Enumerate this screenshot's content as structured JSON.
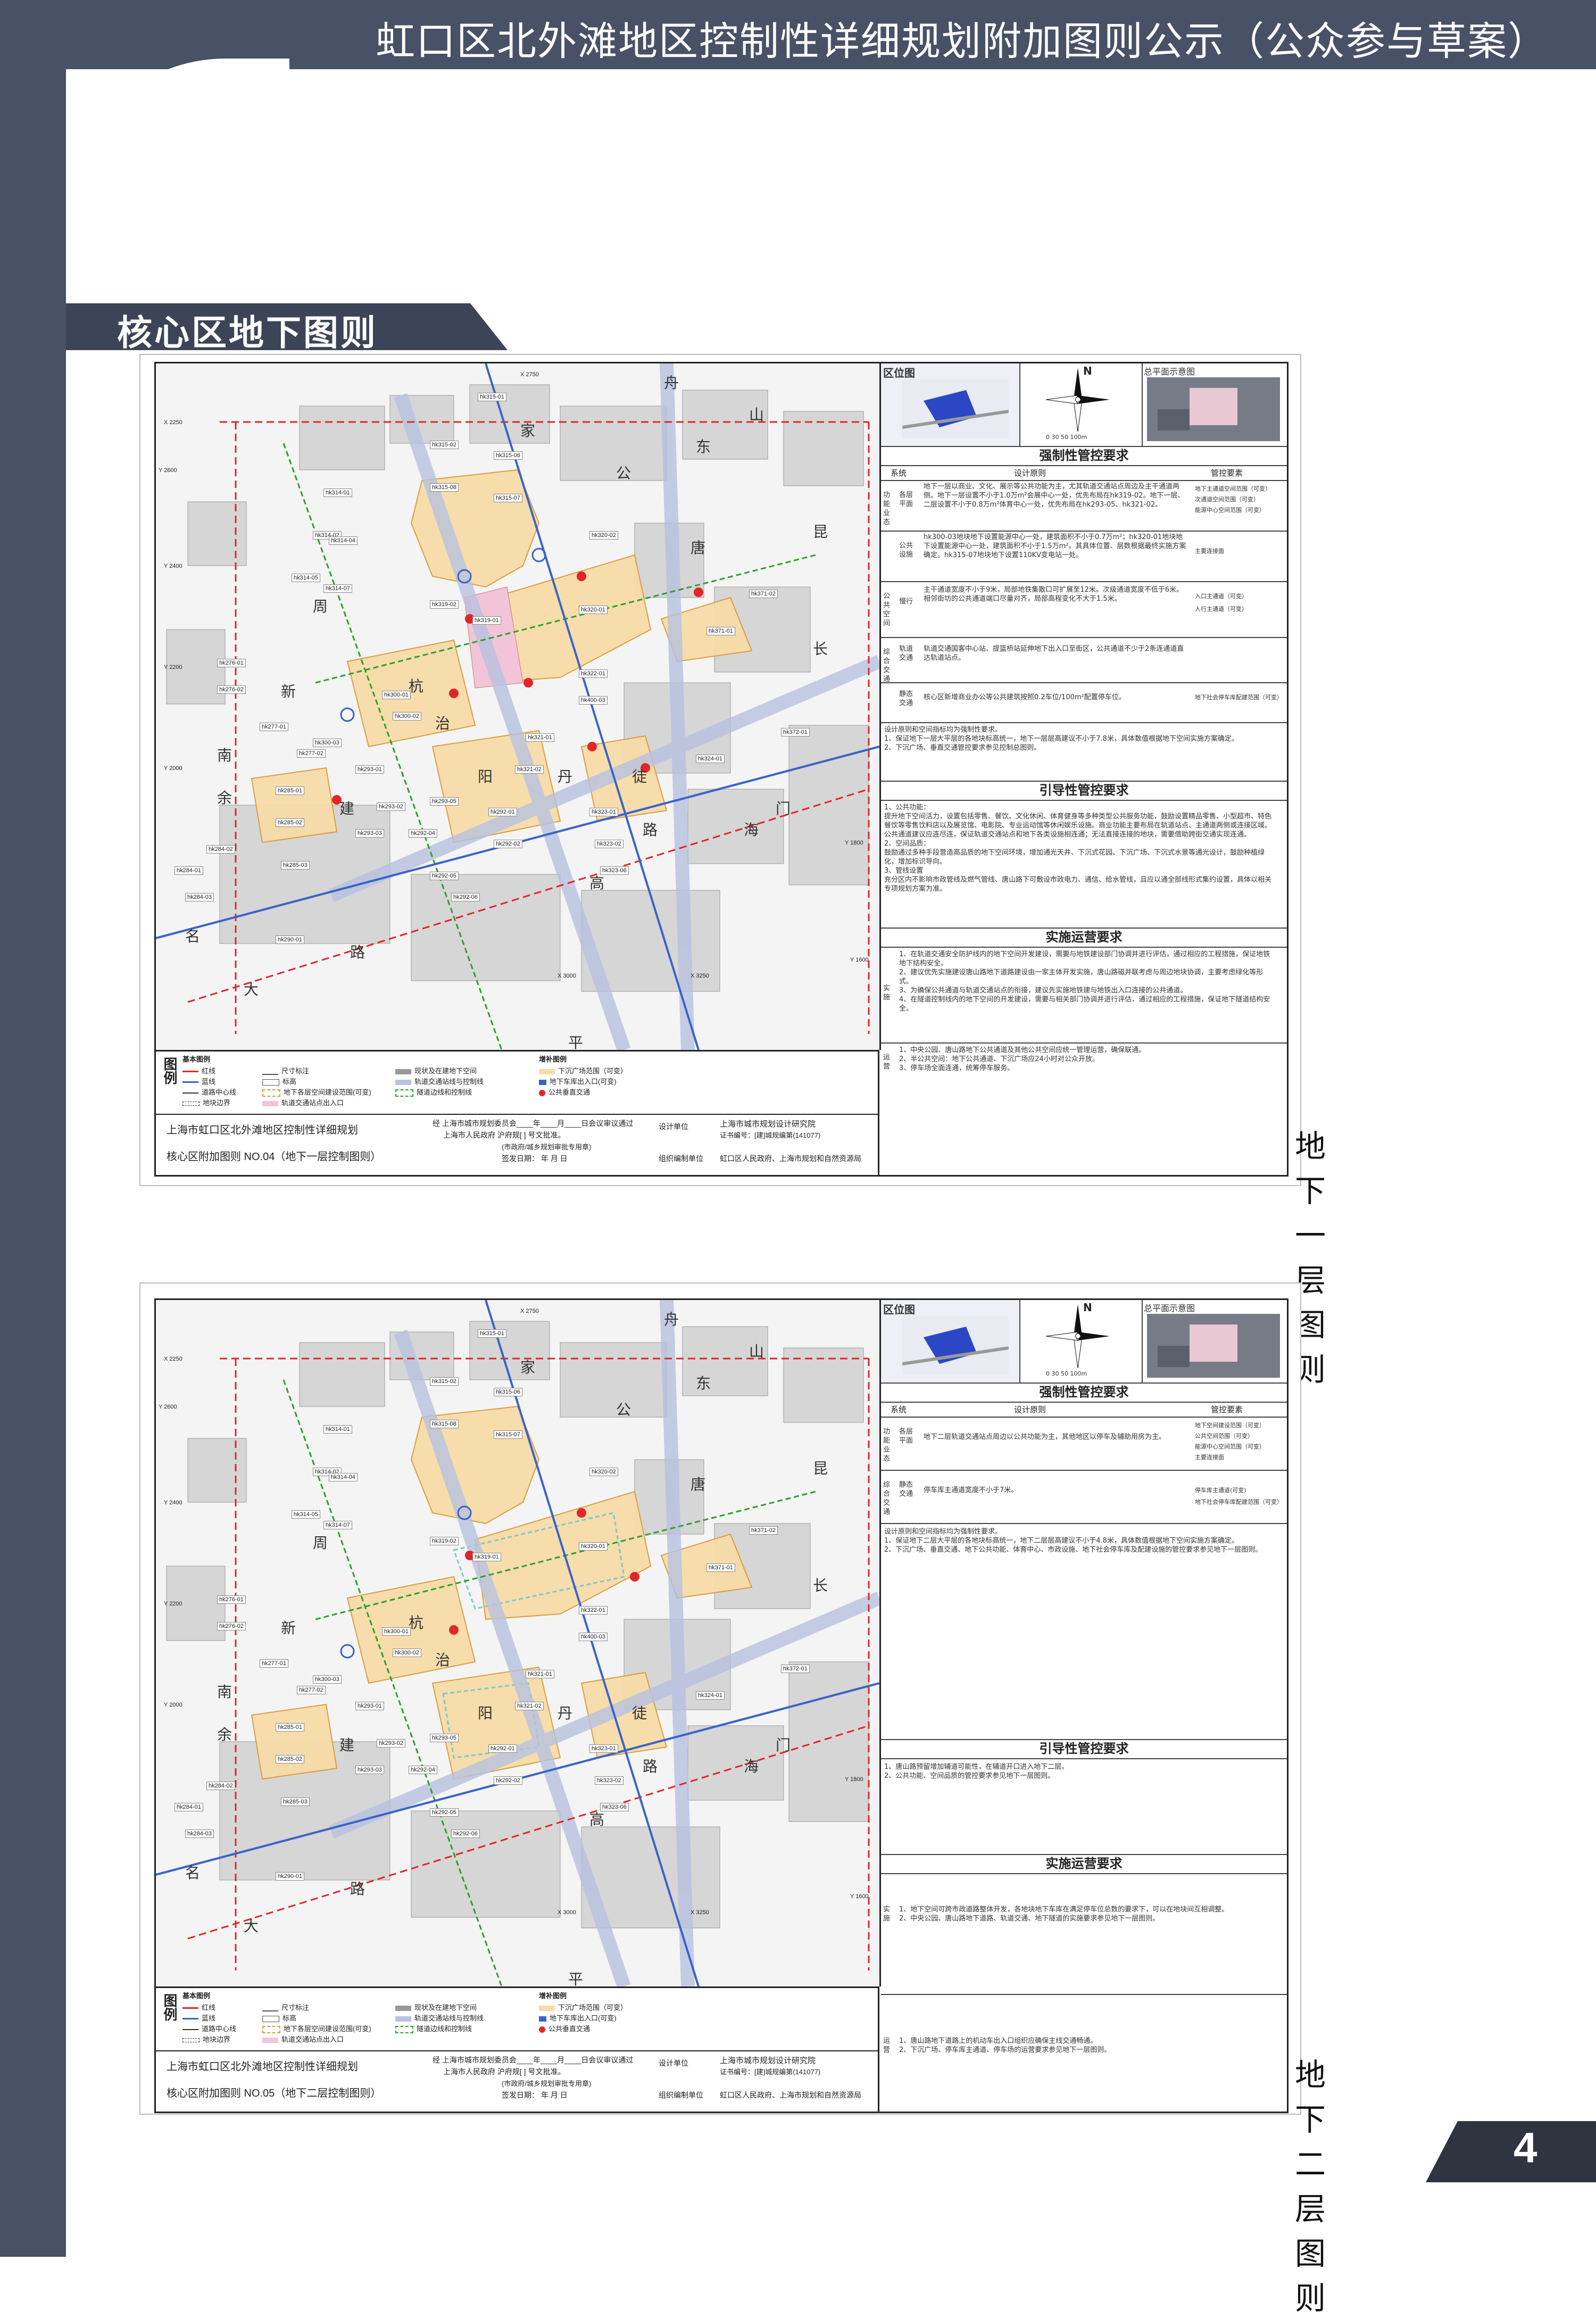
{
  "header": {
    "title": "虹口区北外滩地区控制性详细规划附加图则公示（公众参与草案）",
    "section": "核心区地下图则"
  },
  "page_number": "4",
  "sheets": [
    {
      "caption": "地下一层图则",
      "panel": {
        "location_label": "区位图",
        "overview_label": "总平面示意图",
        "compass": "N",
        "scale": "0  30  50  100m",
        "mandatory_title": "强制性管控要求",
        "guiding_title": "引导性管控要求",
        "implementation_title": "实施运营要求",
        "col_system": "系统",
        "col_principle": "设计原则",
        "col_elements": "管控要素",
        "rows": [
          {
            "group": "功能业态",
            "sub": "各层平面",
            "text": "地下一层以商业、文化、展示等公共功能为主，尤其轨道交通站点周边及主干通道两侧。地下一层设置不小于1.0万m²会展中心一处，优先布局在hk319-02。地下一层、二层设置不小于0.8万m²体育中心一处，优先布局在hk293-05、hk321-02。"
          },
          {
            "group": "",
            "sub": "公共设施",
            "text": "hk300-03地块地下设置能源中心一处，建筑面积不小于0.7万m²；hk320-01地块地下设置能源中心一处，建筑面积不小于1.5万m²。其具体位置、层数根据最终实施方案确定。hk315-07地块地下设置110KV变电站一处。"
          },
          {
            "group": "公共空间",
            "sub": "慢行",
            "text": "主干通道宽度不小于9米，局部地铁集散口可扩展至12米。次级通道宽度不低于6米。相邻街坊的公共通道端口尽量对齐，局部高程变化不大于1.5米。"
          },
          {
            "group": "综合交通",
            "sub": "轨道交通",
            "text": "轨道交通国客中心站、提篮桥站延伸地下出入口至街区，公共通道不少于2条连通道直达轨道站点。"
          },
          {
            "group": "",
            "sub": "静态交通",
            "text": "核心区新增商业办公等公共建筑按照0.2车位/100m²配置停车位。"
          }
        ],
        "element_legend": [
          "地下主通道空间范围（可变）",
          "次通道空间范围（可变）",
          "能源中心空间范围（可变）",
          "主要连接面",
          "入口主通道（可变）",
          "人行主通道（可变）",
          "地下社会停车库配建范围（可变）"
        ],
        "notes": "设计原则和空间指标均为强制性要求。\n1、保证地下一层大平层的各地块标高统一，地下一层层高建议不小于7.8米，具体数值根据地下空间实施方案确定。\n2、下沉广场、垂直交通管控要求参见控制总图则。",
        "guiding_text": "1、公共功能：\n提升地下空间活力，设置包括零售、餐饮、文化休闲、体育健身等多种类型公共服务功能，鼓励设置精品零售、小型超市、特色餐饮等零售饮料店以及展览馆、电影院、专业运动馆等休闲娱乐设施。商业功能主要布局在轨道站点、主通道两侧或连接区域。\n公共通道建议应连尽连，保证轨道交通站点和地下各类设施相连通；无法直接连接的地块，需要借助跨街交通实现连通。\n2、空间品质：\n鼓励通过多种手段营造高品质的地下空间环境，增加通光天井、下沉式花园、下沉广场、下沉式水景等通光设计，鼓励种植绿化，增加标识导向。\n3、管线设置\n充分区内不影响市政管线及燃气管线、唐山路下可敷设市政电力、通信、给水管线，且应以通全部线形式集约设置，具体以相关专项规划方案为准。",
        "impl_text": "1、在轨道交通安全防护线内的地下空间开发建设，需要与地铁建设部门协调并进行评估，通过相应的工程措施，保证地铁地下结构安全。\n2、建议优先实施建设唐山路地下道路建设由一家主体开发实施，唐山路磁并联考虑与周边地块协调，主要考虑绿化等形式。\n3、为确保公共通道与轨道交通站点的衔接，建议先实施地铁建与地铁出入口连接的公共通道。\n4、在隧道控制线内的地下空间的开发建设，需要与相关部门协调并进行评估，通过相应的工程措施，保证地下隧道结构安全。",
        "ops_text": "1、中央公园、唐山路地下公共通道及其他公共空间应统一管理运营，确保联通。\n2、半公共空间：地下公共通道、下沉广场应24小时对公众开放。\n3、停车场全面连通，统筹停车服务。",
        "impl_side": "实施",
        "ops_side": "运营"
      },
      "legend": {
        "title": "图例",
        "basic": "基本图例",
        "added": "增补图例",
        "items": [
          "红线",
          "蓝线",
          "道路中心线",
          "地块边界",
          "尺寸标注",
          "标高",
          "地下各层空间建设范围(可变)",
          "轨道交通站点出入口",
          "现状及在建地下空间",
          "轨道交通站线与控制线",
          "隧道边线和控制线",
          "下沉广场范围（可变）",
          "地下车库出入口(可变)",
          "公共垂直交通"
        ]
      },
      "title_block": {
        "plan_name": "上海市虹口区北外滩地区控制性详细规划",
        "sheet_name": "核心区附加图则  NO.04（地下一层控制图则）",
        "approval1": "经  上海市城市规划委员会____年____月____日会议审议通过",
        "approval2": "上海市人民政府   沪府规[    ]    号文批准。",
        "approval3": "(市政府/城乡规划审批专用章)",
        "approval4": "签发日期：    年    月    日",
        "designer_label": "设计单位",
        "designer": "上海市城市规划设计研究院",
        "cert": "证书编号：[建]城规编第(141077)",
        "org_label": "组织编制单位",
        "org": "虹口区人民政府、上海市规划和自然资源局"
      }
    },
    {
      "caption": "地下二层图则",
      "panel": {
        "location_label": "区位图",
        "overview_label": "总平面示意图",
        "compass": "N",
        "scale": "0  30  50  100m",
        "mandatory_title": "强制性管控要求",
        "guiding_title": "引导性管控要求",
        "implementation_title": "实施运营要求",
        "col_system": "系统",
        "col_principle": "设计原则",
        "col_elements": "管控要素",
        "rows": [
          {
            "group": "功能业态",
            "sub": "各层平面",
            "text": "地下二层轨道交通站点周边以公共功能为主，其他地区以停车及辅助用房为主。"
          },
          {
            "group": "综合交通",
            "sub": "静态交通",
            "text": "停车库主通道宽度不小于7米。"
          }
        ],
        "element_legend": [
          "地下空间建设范围（可变）",
          "公共空间范围（可变）",
          "能源中心空间范围（可变）",
          "主要连接面",
          "停车库主通道(可变)",
          "地下社会停车库配建范围（可变）"
        ],
        "notes": "设计原则和空间指标均为强制性要求。\n1、保证地下二层大平层的各地块标高统一，地下二层层高建议不小于4.8米，具体数值根据地下空间实施方案确定。\n2、下沉广场、垂直交通、地下公共功能、体育中心、市政设施、地下社会停车库及配建设施的管控要求参见地下一层图则。",
        "guiding_text": "1、唐山路预留增加辅道可能性，在辅道开口进入地下二层。\n2、公共功能、空间品质的管控要求参见地下一层图则。",
        "impl_text": "1、地下空间可跨市政道路整体开发，各地块地下车库在满足停车位总数的要求下，可以在地块间互相调整。\n2、中央公园、唐山路地下道路、轨道交通、地下隧道的实施要求参见地下一层图则。",
        "ops_text": "1、唐山路地下道路上的机动车出入口组织应确保主线交通畅通。\n2、下沉广场、停车库主通道、停车场的运营要求参见地下一层图则。",
        "impl_side": "实施",
        "ops_side": "运营"
      },
      "legend": {
        "title": "图例",
        "basic": "基本图例",
        "added": "增补图例",
        "items": [
          "红线",
          "蓝线",
          "道路中心线",
          "地块边界",
          "尺寸标注",
          "标高",
          "地下各层空间建设范围(可变)",
          "轨道交通站点出入口",
          "现状及在建地下空间",
          "轨道交通站线与控制线",
          "隧道边线和控制线",
          "下沉广场范围（可变）",
          "地下车库出入口(可变)",
          "公共垂直交通"
        ]
      },
      "title_block": {
        "plan_name": "上海市虹口区北外滩地区控制性详细规划",
        "sheet_name": "核心区附加图则  NO.05（地下二层控制图则）",
        "approval1": "经  上海市城市规划委员会____年____月____日会议审议通过",
        "approval2": "上海市人民政府   沪府规[    ]    号文批准。",
        "approval3": "(市政府/城乡规划审批专用章)",
        "approval4": "签发日期：    年    月    日",
        "designer_label": "设计单位",
        "designer": "上海市城市规划设计研究院",
        "cert": "证书编号：[建]城规编第(141077)",
        "org_label": "组织编制单位",
        "org": "虹口区人民政府、上海市规划和自然资源局"
      }
    }
  ],
  "map_labels": {
    "roads": [
      "舟",
      "山",
      "东",
      "家",
      "公",
      "唐",
      "昆",
      "长",
      "周",
      "新",
      "杭",
      "治",
      "丹",
      "徒",
      "路",
      "海",
      "门",
      "余",
      "南",
      "建",
      "大",
      "名",
      "平",
      "路",
      "高",
      "阳"
    ],
    "plots": [
      "hk315-01",
      "hk315-02",
      "hk315-06",
      "hk315-08",
      "hk315-07",
      "hk314-01",
      "hk314-02",
      "hk314-04",
      "hk314-05",
      "hk314-07",
      "hk319-02",
      "hk319-01",
      "hk320-01",
      "hk320-02",
      "hk371-01",
      "hk371-02",
      "hk300-01",
      "hk300-02",
      "hk300-03",
      "hk322-01",
      "hk276-01",
      "hk276-02",
      "hk277-01",
      "hk277-02",
      "hk293-01",
      "hk293-02",
      "hk293-03",
      "hk293-05",
      "hk321-01",
      "hk321-02",
      "hk400-03",
      "hk372-01",
      "hk324-01",
      "hk323-01",
      "hk323-02",
      "hk323-06",
      "hk292-01",
      "hk292-02",
      "hk292-04",
      "hk292-05",
      "hk292-06",
      "hk285-01",
      "hk285-02",
      "hk285-03",
      "hk284-01",
      "hk284-02",
      "hk284-03",
      "hk290-01"
    ],
    "coords": [
      "X 2250",
      "X 2750",
      "Y 2600",
      "Y 2400",
      "Y 2200",
      "Y 2000",
      "Y 1800",
      "Y 1600",
      "X 3000",
      "X 3250"
    ]
  },
  "colors": {
    "frame": "#485266",
    "plot_fill": "#f7dca8",
    "red_line": "#e0262a",
    "green_line": "#2ca02c",
    "blue_line": "#3a63c8",
    "building": "#d0d0d0"
  }
}
